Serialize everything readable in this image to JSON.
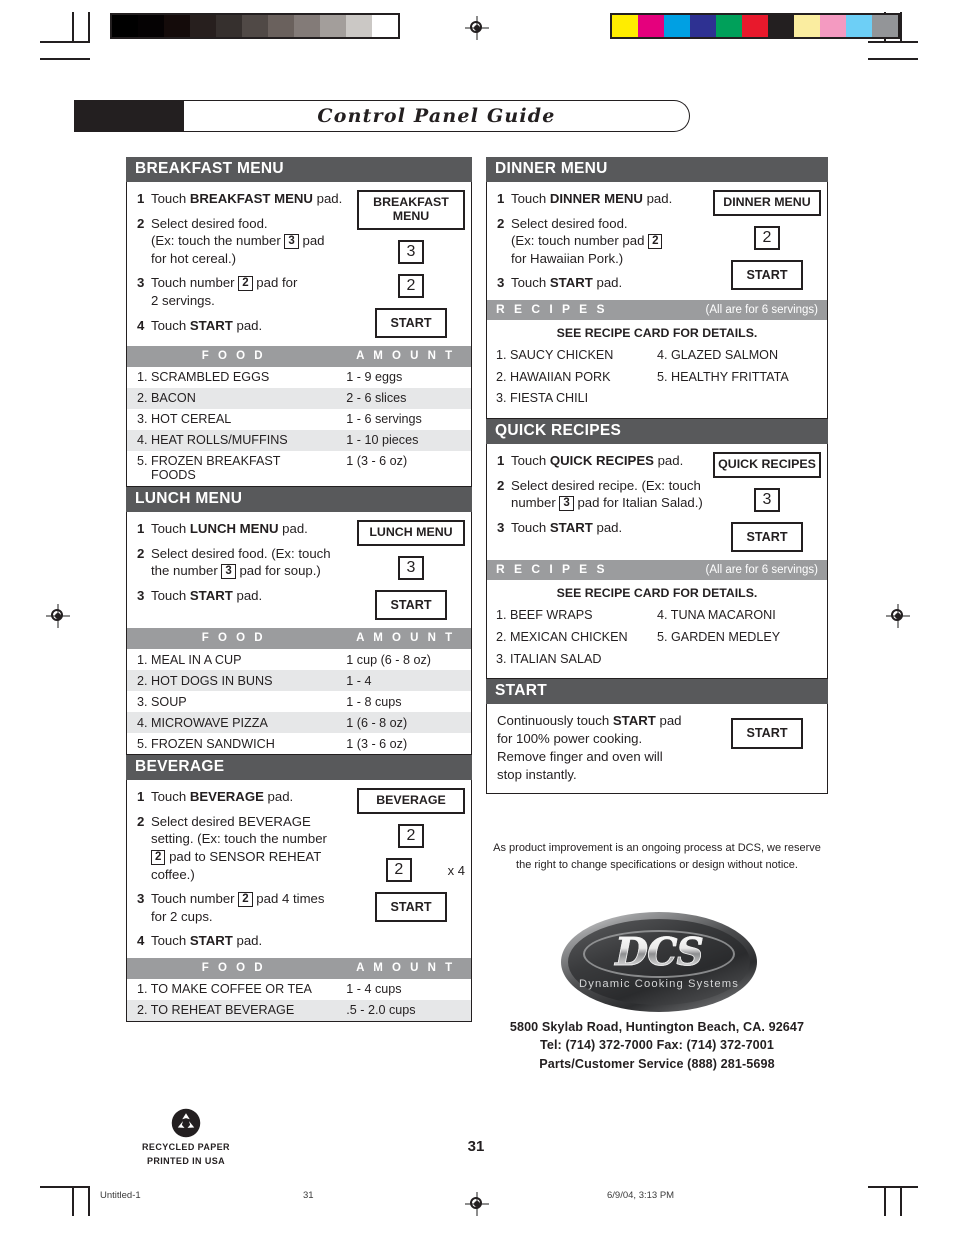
{
  "page": {
    "title": "Control Panel Guide",
    "page_number": "31"
  },
  "color_bars": {
    "grayscale": [
      "#000000",
      "#050203",
      "#140b0a",
      "#271f1e",
      "#36302e",
      "#504946",
      "#6a615d",
      "#837b78",
      "#a39e9b",
      "#cbc8c5",
      "#ffffff"
    ],
    "color": [
      "#ffed00",
      "#e5007d",
      "#00a0e3",
      "#2e3192",
      "#00a05a",
      "#e8192c",
      "#231f20",
      "#faeda0",
      "#f49ac1",
      "#6dcff6",
      "#939598"
    ]
  },
  "breakfast": {
    "header": "BREAKFAST MENU",
    "steps": [
      {
        "n": "1",
        "parts": [
          {
            "t": "Touch "
          },
          {
            "t": "BREAKFAST MENU",
            "b": true
          },
          {
            "t": " pad."
          }
        ]
      },
      {
        "n": "2",
        "parts": [
          {
            "t": "Select desired food."
          },
          {
            "br": true
          },
          {
            "t": "(Ex: touch the number "
          },
          {
            "t": "3",
            "key": true
          },
          {
            "t": " pad"
          },
          {
            "br": true
          },
          {
            "t": "for hot cereal.)"
          }
        ]
      },
      {
        "n": "3",
        "parts": [
          {
            "t": "Touch number "
          },
          {
            "t": "2",
            "key": true
          },
          {
            "t": " pad for"
          },
          {
            "br": true
          },
          {
            "t": "2 servings."
          }
        ]
      },
      {
        "n": "4",
        "parts": [
          {
            "t": "Touch "
          },
          {
            "t": "START",
            "b": true
          },
          {
            "t": " pad."
          }
        ]
      }
    ],
    "pads": [
      {
        "type": "wide",
        "label": "BREAKFAST MENU"
      },
      {
        "type": "num",
        "label": "3"
      },
      {
        "type": "num",
        "label": "2"
      },
      {
        "type": "start",
        "label": "START"
      }
    ],
    "table": {
      "columns": [
        "F O O D",
        "A M O U N T"
      ],
      "rows": [
        {
          "food": "1. SCRAMBLED EGGS",
          "amount": "1 - 9 eggs"
        },
        {
          "food": "2. BACON",
          "amount": "2 - 6 slices"
        },
        {
          "food": "3. HOT CEREAL",
          "amount": "1 - 6 servings"
        },
        {
          "food": "4. HEAT ROLLS/MUFFINS",
          "amount": "1 - 10 pieces"
        },
        {
          "food": "5. FROZEN BREAKFAST",
          "food2": "FOODS",
          "amount": "1 (3 - 6 oz)"
        }
      ]
    }
  },
  "lunch": {
    "header": "LUNCH MENU",
    "steps": [
      {
        "n": "1",
        "parts": [
          {
            "t": "Touch "
          },
          {
            "t": "LUNCH MENU",
            "b": true
          },
          {
            "t": " pad."
          }
        ]
      },
      {
        "n": "2",
        "parts": [
          {
            "t": "Select desired food. (Ex: touch"
          },
          {
            "br": true
          },
          {
            "t": "the number "
          },
          {
            "t": "3",
            "key": true
          },
          {
            "t": " pad for soup.)"
          }
        ]
      },
      {
        "n": "3",
        "parts": [
          {
            "t": "Touch "
          },
          {
            "t": "START",
            "b": true
          },
          {
            "t": " pad."
          }
        ]
      }
    ],
    "pads": [
      {
        "type": "wide",
        "label": "LUNCH MENU"
      },
      {
        "type": "num",
        "label": "3"
      },
      {
        "type": "start",
        "label": "START"
      }
    ],
    "table": {
      "columns": [
        "F O O D",
        "A M O U N T"
      ],
      "rows": [
        {
          "food": "1. MEAL IN A CUP",
          "amount": "1 cup (6 - 8 oz)"
        },
        {
          "food": "2. HOT DOGS IN BUNS",
          "amount": "1 - 4"
        },
        {
          "food": "3. SOUP",
          "amount": "1 - 8 cups"
        },
        {
          "food": "4. MICROWAVE PIZZA",
          "amount": "1 (6 - 8 oz)"
        },
        {
          "food": "5. FROZEN SANDWICH",
          "amount": "1 (3 - 6 oz)"
        }
      ]
    }
  },
  "beverage": {
    "header": "BEVERAGE",
    "steps": [
      {
        "n": "1",
        "parts": [
          {
            "t": "Touch "
          },
          {
            "t": "BEVERAGE",
            "b": true
          },
          {
            "t": " pad."
          }
        ]
      },
      {
        "n": "2",
        "parts": [
          {
            "t": "Select desired BEVERAGE"
          },
          {
            "br": true
          },
          {
            "t": "setting. (Ex: touch the number"
          },
          {
            "br": true
          },
          {
            "t": "2",
            "key": true
          },
          {
            "t": " pad to SENSOR REHEAT"
          },
          {
            "br": true
          },
          {
            "t": "coffee.)"
          }
        ]
      },
      {
        "n": "3",
        "parts": [
          {
            "t": "Touch number "
          },
          {
            "t": "2",
            "key": true
          },
          {
            "t": " pad 4 times"
          },
          {
            "br": true
          },
          {
            "t": "for 2 cups."
          }
        ]
      },
      {
        "n": "4",
        "parts": [
          {
            "t": "Touch "
          },
          {
            "t": "START",
            "b": true
          },
          {
            "t": " pad."
          }
        ]
      }
    ],
    "pads": [
      {
        "type": "wide",
        "label": "BEVERAGE"
      },
      {
        "type": "num",
        "label": "2"
      },
      {
        "type": "num-times",
        "label": "2",
        "suffix": "x 4"
      },
      {
        "type": "start",
        "label": "START"
      }
    ],
    "table": {
      "columns": [
        "F O O D",
        "A M O U N T"
      ],
      "rows": [
        {
          "food": "1. TO MAKE COFFEE OR TEA",
          "amount": "1 - 4 cups"
        },
        {
          "food": "2. TO REHEAT BEVERAGE",
          "amount": ".5 - 2.0 cups"
        }
      ]
    }
  },
  "dinner": {
    "header": "DINNER MENU",
    "steps": [
      {
        "n": "1",
        "parts": [
          {
            "t": "Touch "
          },
          {
            "t": "DINNER MENU",
            "b": true
          },
          {
            "t": " pad."
          }
        ]
      },
      {
        "n": "2",
        "parts": [
          {
            "t": "Select desired food."
          },
          {
            "br": true
          },
          {
            "t": "(Ex: touch number pad "
          },
          {
            "t": "2",
            "key": true
          },
          {
            "br": true
          },
          {
            "t": "for Hawaiian Pork.)"
          }
        ]
      },
      {
        "n": "3",
        "parts": [
          {
            "t": "Touch "
          },
          {
            "t": "START",
            "b": true
          },
          {
            "t": " pad."
          }
        ]
      }
    ],
    "pads": [
      {
        "type": "wide",
        "label": "DINNER MENU"
      },
      {
        "type": "num",
        "label": "2"
      },
      {
        "type": "start",
        "label": "START"
      }
    ],
    "recipes": {
      "header": "R E C I P E S",
      "note": "(All are for 6 servings)",
      "subtitle": "SEE RECIPE CARD FOR DETAILS.",
      "left": [
        "1. SAUCY CHICKEN",
        "2. HAWAIIAN PORK",
        "3. FIESTA CHILI"
      ],
      "right": [
        "4. GLAZED SALMON",
        "5. HEALTHY FRITTATA"
      ]
    }
  },
  "quick": {
    "header": "QUICK RECIPES",
    "steps": [
      {
        "n": "1",
        "parts": [
          {
            "t": "Touch "
          },
          {
            "t": "QUICK RECIPES",
            "b": true
          },
          {
            "t": " pad."
          }
        ]
      },
      {
        "n": "2",
        "parts": [
          {
            "t": "Select desired recipe. (Ex: touch"
          },
          {
            "br": true
          },
          {
            "t": "number "
          },
          {
            "t": "3",
            "key": true
          },
          {
            "t": " pad for Italian Salad.)"
          }
        ]
      },
      {
        "n": "3",
        "parts": [
          {
            "t": "Touch "
          },
          {
            "t": "START",
            "b": true
          },
          {
            "t": " pad."
          }
        ]
      }
    ],
    "pads": [
      {
        "type": "wide",
        "label": "QUICK RECIPES"
      },
      {
        "type": "num",
        "label": "3"
      },
      {
        "type": "start",
        "label": "START"
      }
    ],
    "recipes": {
      "header": "R E C I P E S",
      "note": "(All are for 6 servings)",
      "subtitle": "SEE RECIPE CARD FOR DETAILS.",
      "left": [
        "1. BEEF WRAPS",
        "2. MEXICAN CHICKEN",
        "3. ITALIAN SALAD"
      ],
      "right": [
        "4. TUNA MACARONI",
        "5. GARDEN MEDLEY"
      ]
    }
  },
  "start": {
    "header": "START",
    "body_parts": [
      {
        "t": "Continuously touch "
      },
      {
        "t": "START",
        "b": true
      },
      {
        "t": " pad"
      },
      {
        "br": true
      },
      {
        "t": "for 100% power cooking."
      },
      {
        "br": true
      },
      {
        "t": "Remove finger and oven will"
      },
      {
        "br": true
      },
      {
        "t": "stop instantly."
      }
    ],
    "pad": "START"
  },
  "disclaimer": "As product improvement is an ongoing process at DCS, we reserve the right to change specifications or design without notice.",
  "logo": {
    "mark": "DCS",
    "tagline": "Dynamic Cooking Systems"
  },
  "address": {
    "line1": "5800 Skylab Road, Huntington Beach, CA. 92647",
    "line2": "Tel: (714) 372-7000 Fax: (714) 372-7001",
    "line3": "Parts/Customer Service  (888) 281-5698"
  },
  "recycle": {
    "line1": "RECYCLED PAPER",
    "line2": "PRINTED IN USA"
  },
  "print_footer": {
    "file": "Untitled-1",
    "page": "31",
    "timestamp": "6/9/04, 3:13 PM"
  }
}
